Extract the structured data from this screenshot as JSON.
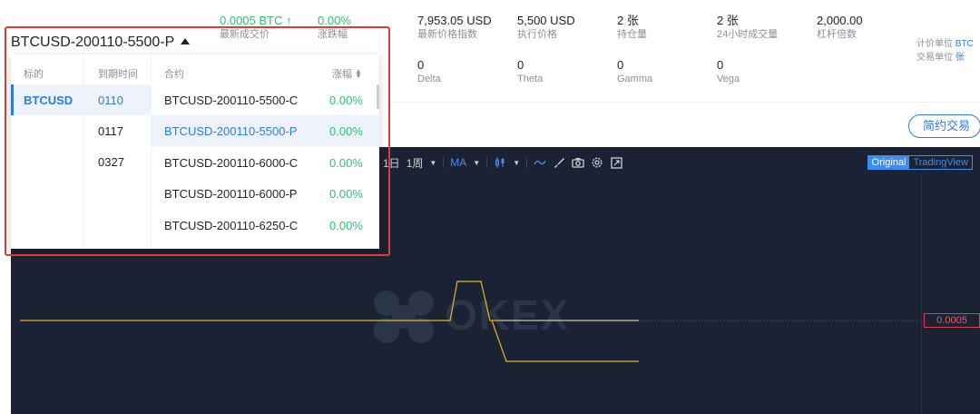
{
  "selector": {
    "title": "BTCUSD-200110-5500-P"
  },
  "ticker": {
    "last_price": {
      "value": "0.0005 BTC ↑",
      "label": "最新成交价"
    },
    "change": {
      "value": "0.00%",
      "label": "涨跌幅"
    },
    "index_price": {
      "value": "7,953.05 USD",
      "label": "最新价格指数"
    },
    "strike": {
      "value": "5,500 USD",
      "label": "执行价格"
    },
    "position": {
      "value": "2 张",
      "label": "持仓量"
    },
    "volume_24h": {
      "value": "2 张",
      "label": "24小时成交量"
    },
    "leverage": {
      "value": "2,000.00",
      "label": "杠杆倍数"
    },
    "delta": {
      "value": "0",
      "label": "Delta"
    },
    "theta": {
      "value": "0",
      "label": "Theta"
    },
    "gamma": {
      "value": "0",
      "label": "Gamma"
    },
    "vega": {
      "value": "0",
      "label": "Vega"
    },
    "quote_unit": {
      "label": "计价单位",
      "value": "BTC"
    },
    "trade_unit": {
      "label": "交易单位",
      "value": "张"
    }
  },
  "simple_trade_label": "简约交易",
  "dropdown": {
    "headers": {
      "underlying": "标的",
      "expiry": "到期时间",
      "contract": "合约",
      "change": "涨幅"
    },
    "underlyings": [
      "BTCUSD"
    ],
    "expiries": [
      "0110",
      "0117",
      "0327"
    ],
    "contracts": [
      {
        "name": "BTCUSD-200110-5500-C",
        "change": "0.00%"
      },
      {
        "name": "BTCUSD-200110-5500-P",
        "change": "0.00%"
      },
      {
        "name": "BTCUSD-200110-6000-C",
        "change": "0.00%"
      },
      {
        "name": "BTCUSD-200110-6000-P",
        "change": "0.00%"
      },
      {
        "name": "BTCUSD-200110-6250-C",
        "change": "0.00%"
      }
    ]
  },
  "chart": {
    "toolbar": {
      "day": "1日",
      "week": "1周",
      "indicator": "MA"
    },
    "view_switch": {
      "original": "Original",
      "tradingview": "TradingView"
    },
    "price_tag": "0.0005",
    "watermark": "OKEX",
    "colors": {
      "background": "#1a2234",
      "line": "#e6b422",
      "accent": "#3d8cf0",
      "price_tag": "#d8404a"
    }
  }
}
